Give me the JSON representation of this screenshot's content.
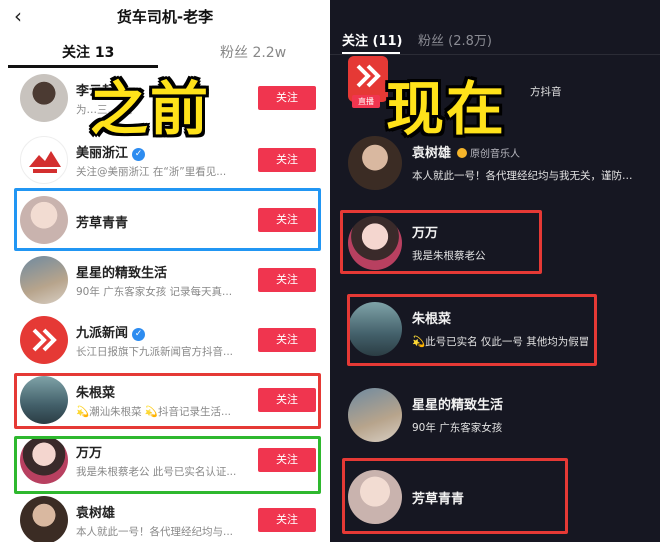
{
  "left_panel": {
    "back_icon": "chevron-left-icon",
    "title": "货车司机-老李",
    "tabs": [
      {
        "label": "关注 13",
        "active": true
      },
      {
        "label": "粉丝 2.2w",
        "active": false
      }
    ],
    "caption": "之前",
    "items": [
      {
        "name": "李云起",
        "desc": "为…三… 流",
        "button": "关注",
        "verified": false
      },
      {
        "name": "美丽浙江",
        "desc": "关注@美丽浙江 在“浙”里看见...",
        "button": "关注",
        "verified": true
      },
      {
        "name": "芳草青青",
        "desc": "",
        "button": "关注",
        "verified": false
      },
      {
        "name": "星星的精致生活",
        "desc": "90年 广东客家女孩 记录每天真...",
        "button": "关注",
        "verified": false
      },
      {
        "name": "九派新闻",
        "desc": "长江日报旗下九派新闻官方抖音...",
        "button": "关注",
        "verified": true
      },
      {
        "name": "朱根菜",
        "desc": "💫潮汕朱根菜 💫抖音记录生活...",
        "button": "关注",
        "verified": false
      },
      {
        "name": "万万",
        "desc": "我是朱根蔡老公 此号已实名认证...",
        "button": "关注",
        "verified": false
      },
      {
        "name": "袁树雄",
        "desc": "本人就此一号！各代理经纪均与...",
        "button": "关注",
        "verified": false
      }
    ],
    "highlight_colors": {
      "blue": "#2196f3",
      "red": "#e53935",
      "green": "#2eb82e"
    }
  },
  "right_panel": {
    "tabs": [
      {
        "label": "关注 (11)",
        "active": true
      },
      {
        "label": "粉丝 (2.8万)",
        "active": false
      }
    ],
    "caption": "现在",
    "top_partial": {
      "desc": "方抖音",
      "live_badge": "直播"
    },
    "items": [
      {
        "name": "袁树雄",
        "tag": "原创音乐人",
        "desc": "本人就此一号！各代理经纪均与我无关，谨防上..."
      },
      {
        "name": "万万",
        "tag": "",
        "desc": "我是朱根蔡老公"
      },
      {
        "name": "朱根菜",
        "tag": "",
        "desc": "💫此号已实名 仅此一号 其他均为假冒"
      },
      {
        "name": "星星的精致生活",
        "tag": "",
        "desc": "90年 广东客家女孩"
      },
      {
        "name": "芳草青青",
        "tag": "",
        "desc": ""
      }
    ]
  },
  "colors": {
    "follow_button": "#f0354f",
    "dark_bg": "#161722",
    "caption_yellow": "#ffe21a"
  }
}
